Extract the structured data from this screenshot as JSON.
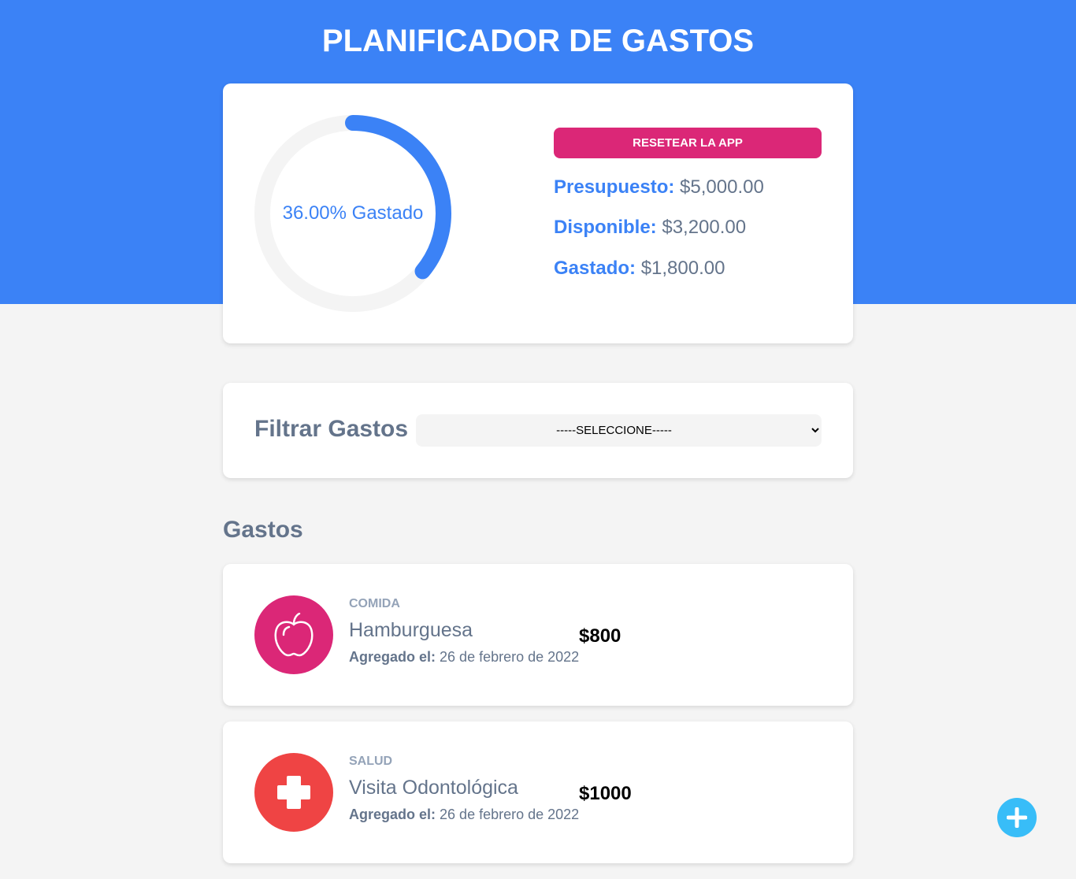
{
  "app": {
    "title": "PLANIFICADOR DE GASTOS"
  },
  "budget": {
    "spent_percent": 36.0,
    "progress_text": "36.00% Gastado",
    "reset_label": "RESETEAR LA APP",
    "presupuesto_label": "Presupuesto:",
    "presupuesto_value": "$5,000.00",
    "disponible_label": "Disponible:",
    "disponible_value": "$3,200.00",
    "gastado_label": "Gastado:",
    "gastado_value": "$1,800.00"
  },
  "filter": {
    "label": "Filtrar Gastos",
    "selected": "-----SELECCIONE-----"
  },
  "expenses_section": {
    "title": "Gastos"
  },
  "expenses": [
    {
      "category": "COMIDA",
      "name": "Hamburguesa",
      "date_label": "Agregado el:",
      "date_value": "26 de febrero de 2022",
      "amount": "$800",
      "icon": "apple-icon",
      "color": "#db2777"
    },
    {
      "category": "SALUD",
      "name": "Visita Odontológica",
      "date_label": "Agregado el:",
      "date_value": "26 de febrero de 2022",
      "amount": "$1000",
      "icon": "health-cross-icon",
      "color": "#ef4444"
    }
  ],
  "colors": {
    "primary": "#3b82f6",
    "accent": "#db2777",
    "fab": "#38bdf8"
  },
  "fab": {
    "icon": "plus-icon"
  }
}
